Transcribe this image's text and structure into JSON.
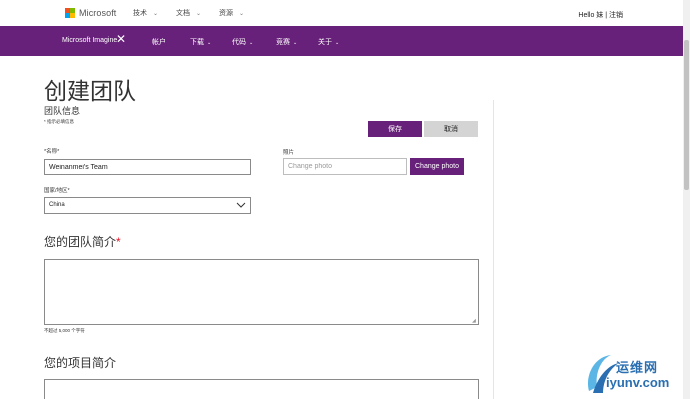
{
  "header": {
    "brand": "Microsoft",
    "nav": [
      {
        "label": "技术"
      },
      {
        "label": "文档"
      },
      {
        "label": "资源"
      }
    ],
    "user_text": "Hello 妹 | 注销"
  },
  "subnav": {
    "brand": "Microsoft Imagine",
    "items": [
      {
        "label": "帐户"
      },
      {
        "label": "下载"
      },
      {
        "label": "代码"
      },
      {
        "label": "竞赛"
      },
      {
        "label": "关于"
      }
    ]
  },
  "page": {
    "title": "创建团队",
    "section_title": "团队信息",
    "required_note": "* 指示必填信息",
    "save_label": "保存",
    "cancel_label": "取消"
  },
  "form": {
    "name_label": "*名称*",
    "name_value": "Weinanmei's Team",
    "photo_label": "照片",
    "photo_placeholder": "Change photo",
    "photo_button": "Change photo",
    "country_label": "国家/地区*",
    "country_value": "China",
    "team_intro_heading": "您的团队简介",
    "team_intro_star": "*",
    "limit_note": "不超过 5,000 个字符",
    "project_intro_heading": "您的项目简介"
  },
  "watermark": {
    "cn": "运维网",
    "en": "iyunv.com"
  },
  "colors": {
    "brand_purple": "#68217a",
    "required_red": "#e81123",
    "ms_red": "#f25022",
    "ms_green": "#7fba00",
    "ms_blue": "#00a4ef",
    "ms_yellow": "#ffb900"
  }
}
